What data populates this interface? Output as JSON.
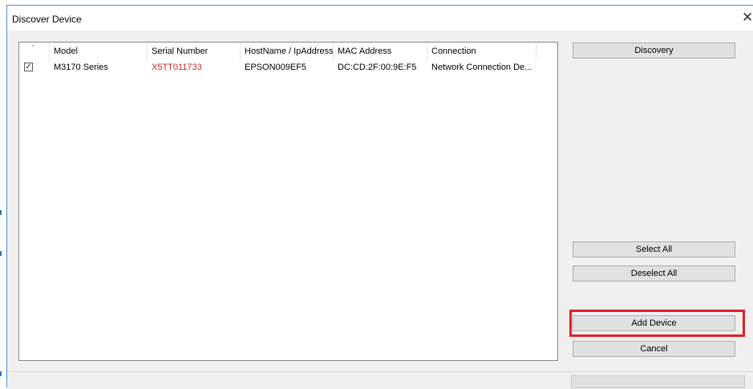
{
  "window": {
    "title": "Discover Device",
    "close_glyph": "✕"
  },
  "device_list": {
    "columns": [
      "Model",
      "Serial Number",
      "HostName / IpAddress",
      "MAC Address",
      "Connection"
    ],
    "rows": [
      {
        "checked": true,
        "checkbox_glyph": "✓",
        "model": "M3170 Series",
        "serial": "X5TT011733",
        "host": "EPSON009EF5",
        "mac": "DC:CD:2F:00:9E:F5",
        "connection": "Network Connection De..."
      }
    ]
  },
  "buttons": {
    "discovery": "Discovery",
    "select_all": "Select All",
    "deselect_all": "Deselect All",
    "add_device": "Add Device",
    "cancel": "Cancel"
  },
  "colors": {
    "serial_text": "#c0282d",
    "highlight_border": "#e0202a",
    "window_accent": "#4a90d9"
  }
}
